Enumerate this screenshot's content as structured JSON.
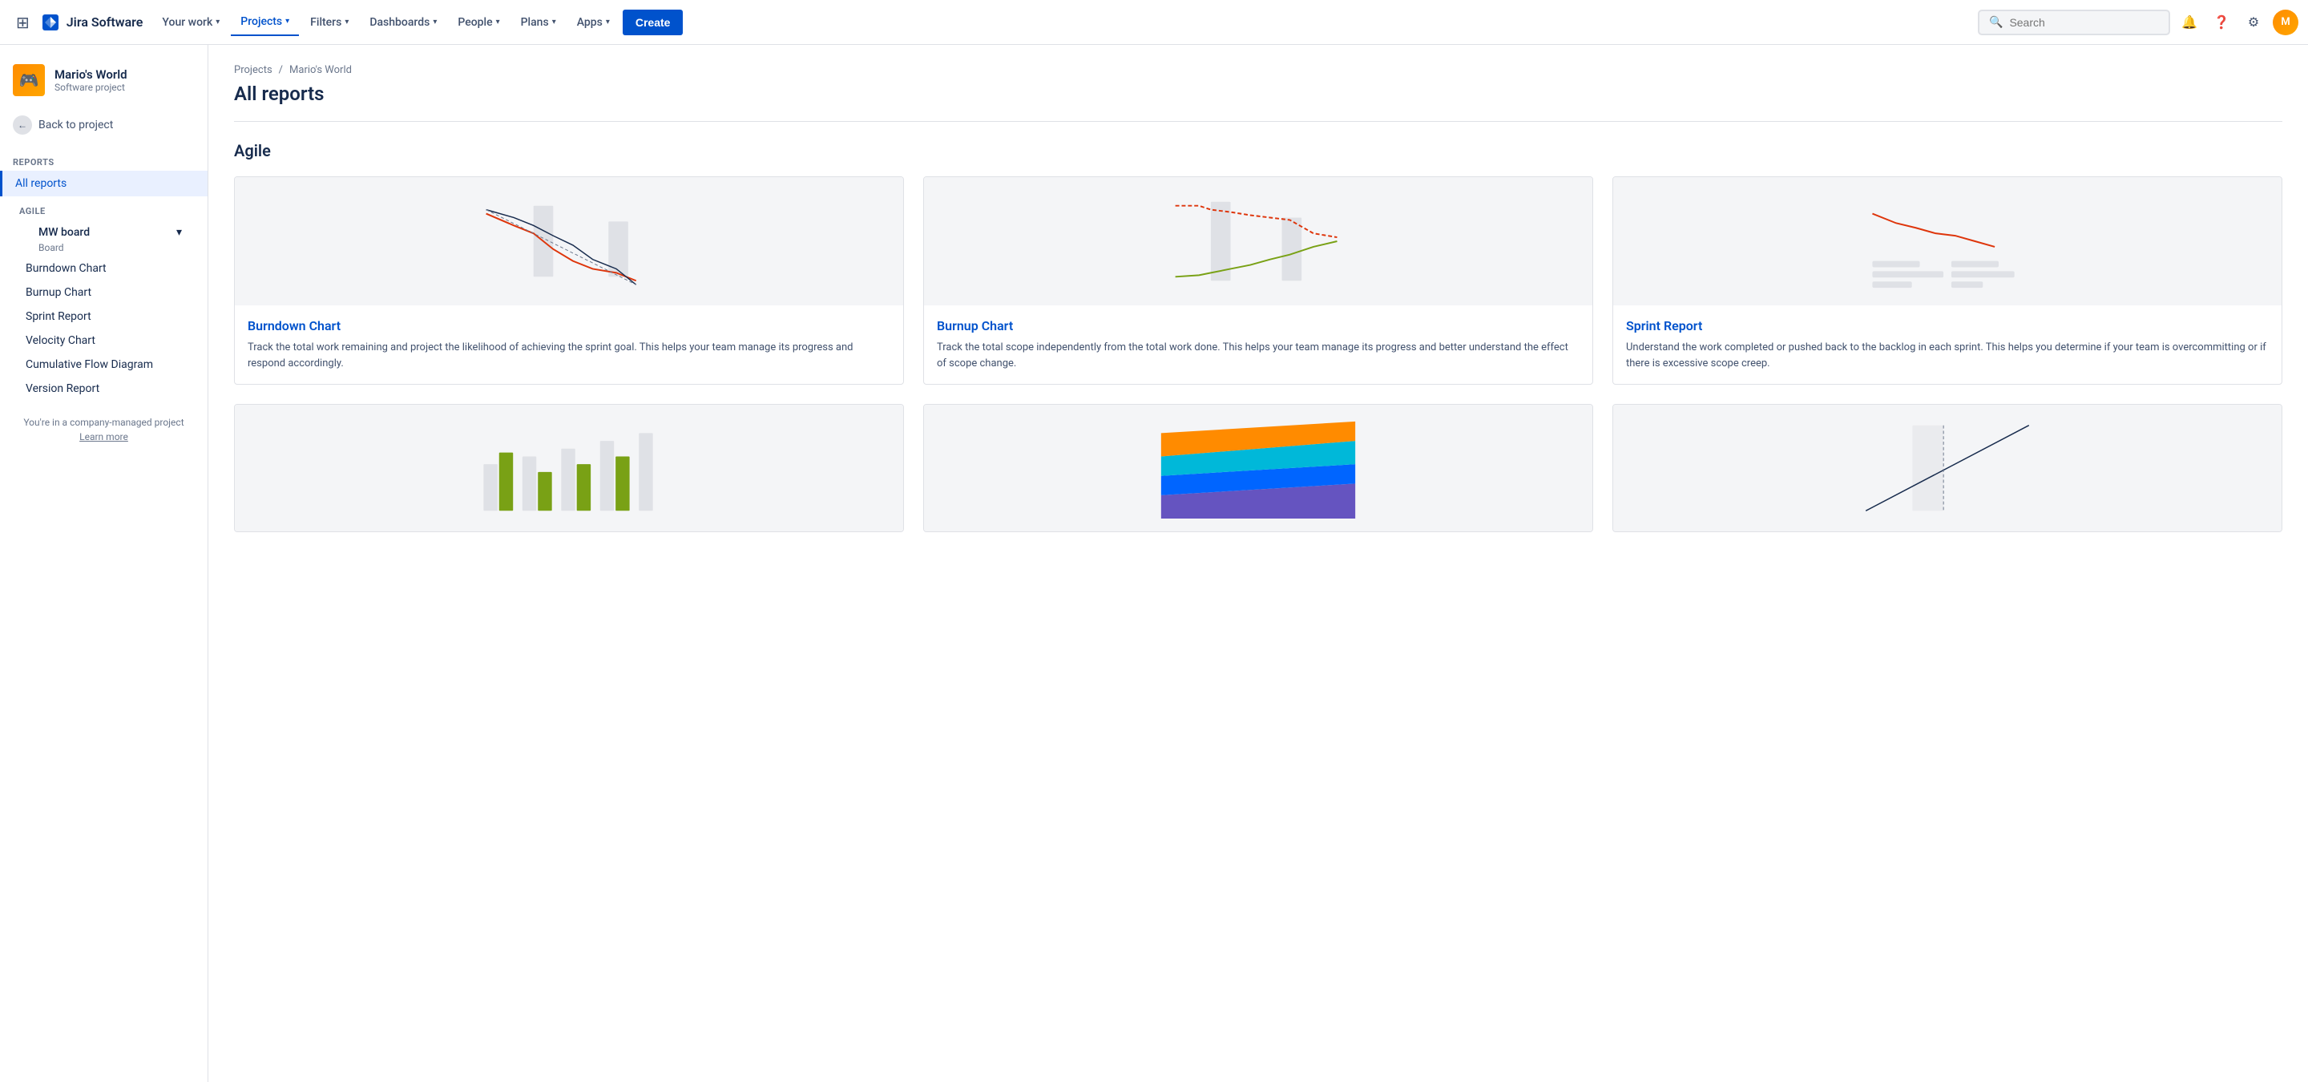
{
  "topnav": {
    "logo_text": "Jira Software",
    "nav_items": [
      {
        "label": "Your work",
        "id": "your-work",
        "active": false
      },
      {
        "label": "Projects",
        "id": "projects",
        "active": true
      },
      {
        "label": "Filters",
        "id": "filters",
        "active": false
      },
      {
        "label": "Dashboards",
        "id": "dashboards",
        "active": false
      },
      {
        "label": "People",
        "id": "people",
        "active": false
      },
      {
        "label": "Plans",
        "id": "plans",
        "active": false
      },
      {
        "label": "Apps",
        "id": "apps",
        "active": false
      }
    ],
    "create_label": "Create",
    "search_placeholder": "Search"
  },
  "sidebar": {
    "project_name": "Mario's World",
    "project_type": "Software project",
    "back_label": "Back to project",
    "reports_title": "Reports",
    "all_reports_label": "All reports",
    "agile_label": "AGILE",
    "board_name": "MW board",
    "board_type": "Board",
    "menu_items": [
      {
        "label": "Burndown Chart",
        "id": "burndown"
      },
      {
        "label": "Burnup Chart",
        "id": "burnup"
      },
      {
        "label": "Sprint Report",
        "id": "sprint"
      },
      {
        "label": "Velocity Chart",
        "id": "velocity"
      },
      {
        "label": "Cumulative Flow Diagram",
        "id": "cfd"
      },
      {
        "label": "Version Report",
        "id": "version"
      }
    ],
    "company_note": "You're in a company-managed project",
    "learn_more": "Learn more"
  },
  "breadcrumb": {
    "projects_label": "Projects",
    "project_label": "Mario's World"
  },
  "main": {
    "page_title": "All reports",
    "section_title": "Agile",
    "cards": [
      {
        "id": "burndown",
        "title": "Burndown Chart",
        "desc": "Track the total work remaining and project the likelihood of achieving the sprint goal. This helps your team manage its progress and respond accordingly."
      },
      {
        "id": "burnup",
        "title": "Burnup Chart",
        "desc": "Track the total scope independently from the total work done. This helps your team manage its progress and better understand the effect of scope change."
      },
      {
        "id": "sprint",
        "title": "Sprint Report",
        "desc": "Understand the work completed or pushed back to the backlog in each sprint. This helps you determine if your team is overcommitting or if there is excessive scope creep."
      }
    ]
  }
}
